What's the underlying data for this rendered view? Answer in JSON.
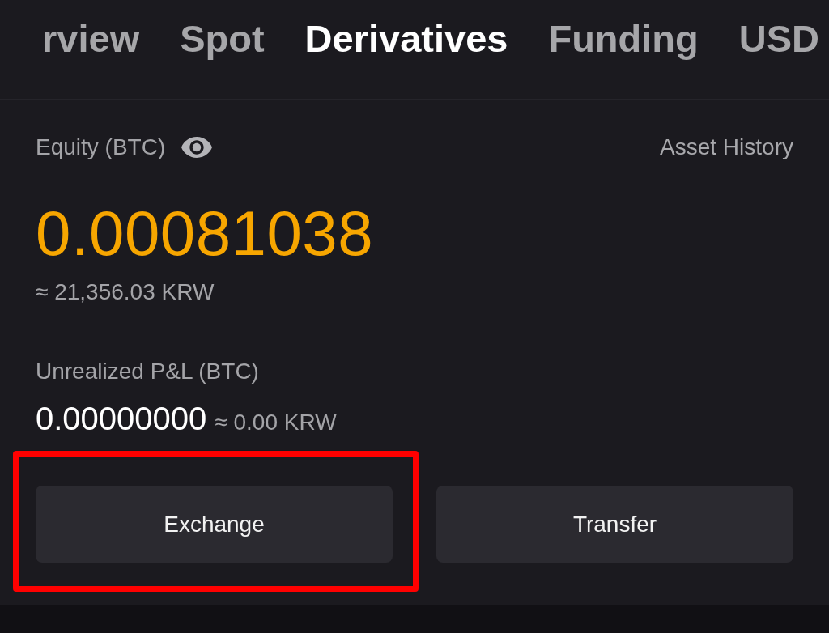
{
  "tabs": [
    {
      "label": "rview",
      "selected": false
    },
    {
      "label": "Spot",
      "selected": false
    },
    {
      "label": "Derivatives",
      "selected": true
    },
    {
      "label": "Funding",
      "selected": false
    },
    {
      "label": "USD",
      "selected": false
    }
  ],
  "equity": {
    "label": "Equity (BTC)",
    "link": "Asset History",
    "value": "0.00081038",
    "fiat_value": "≈ 21,356.03 KRW"
  },
  "unrealized_pnl": {
    "label": "Unrealized P&L (BTC)",
    "value": "0.00000000",
    "fiat_value": "≈ 0.00 KRW"
  },
  "actions": [
    {
      "label": "Exchange",
      "highlighted": true
    },
    {
      "label": "Transfer",
      "highlighted": false
    }
  ]
}
